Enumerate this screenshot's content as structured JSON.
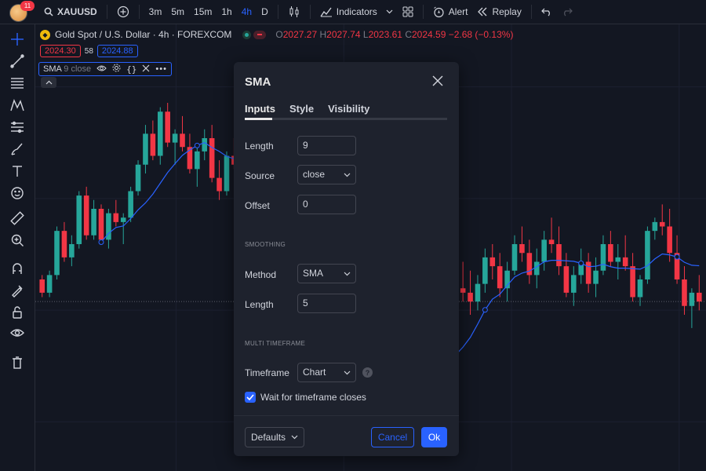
{
  "topbar": {
    "notification_count": "11",
    "symbol": "XAUUSD",
    "timeframes": [
      "3m",
      "5m",
      "15m",
      "1h",
      "4h",
      "D"
    ],
    "active_timeframe": "4h",
    "indicators_label": "Indicators",
    "alert_label": "Alert",
    "replay_label": "Replay"
  },
  "legend": {
    "title": "Gold Spot / U.S. Dollar · 4h · FOREXCOM",
    "open_key": "O",
    "open": "2027.27",
    "high_key": "H",
    "high": "2027.74",
    "low_key": "L",
    "low": "2023.61",
    "close_key": "C",
    "close": "2024.59",
    "change": "−2.68 (−0.13%)",
    "bid": "2024.30",
    "spread": "58",
    "ask": "2024.88",
    "indicator_name": "SMA",
    "indicator_params": "9 close"
  },
  "colors": {
    "up": "#26a69a",
    "down": "#f23645",
    "sma_line": "#2962ff",
    "accent": "#2962ff"
  },
  "left_tools": [
    "crosshair-icon",
    "trend-line-icon",
    "fib-icon",
    "pattern-icon",
    "prediction-icon",
    "brush-icon",
    "text-icon",
    "emoji-icon",
    "ruler-icon",
    "zoom-icon",
    "magnet-icon",
    "lock-drawing-icon",
    "lock-icon",
    "eye-icon",
    "trash-icon"
  ],
  "dialog": {
    "title": "SMA",
    "tabs": [
      "Inputs",
      "Style",
      "Visibility"
    ],
    "active_tab": "Inputs",
    "length_label": "Length",
    "length_value": "9",
    "source_label": "Source",
    "source_value": "close",
    "offset_label": "Offset",
    "offset_value": "0",
    "smoothing_section": "SMOOTHING",
    "method_label": "Method",
    "method_value": "SMA",
    "smoothing_length_label": "Length",
    "smoothing_length_value": "5",
    "mtf_section": "MULTI TIMEFRAME",
    "timeframe_label": "Timeframe",
    "timeframe_value": "Chart",
    "wait_label": "Wait for timeframe closes",
    "wait_checked": true,
    "defaults_label": "Defaults",
    "cancel_label": "Cancel",
    "ok_label": "Ok"
  },
  "chart_data": {
    "type": "candlestick",
    "symbol": "XAUUSD",
    "interval": "4h",
    "ohlc": [
      [
        100,
        101,
        96,
        97
      ],
      [
        97,
        102,
        96,
        101
      ],
      [
        101,
        112,
        100,
        111
      ],
      [
        111,
        113,
        104,
        105
      ],
      [
        105,
        110,
        103,
        108
      ],
      [
        108,
        120,
        107,
        119
      ],
      [
        119,
        121,
        109,
        110
      ],
      [
        110,
        118,
        109,
        116
      ],
      [
        116,
        117,
        108,
        109
      ],
      [
        109,
        116,
        107,
        115
      ],
      [
        115,
        118,
        112,
        113
      ],
      [
        113,
        115,
        108,
        114
      ],
      [
        114,
        121,
        113,
        120
      ],
      [
        120,
        127,
        119,
        126
      ],
      [
        126,
        135,
        124,
        133
      ],
      [
        133,
        136,
        127,
        128
      ],
      [
        128,
        139,
        126,
        138
      ],
      [
        138,
        140,
        130,
        131
      ],
      [
        131,
        134,
        126,
        133
      ],
      [
        133,
        137,
        129,
        130
      ],
      [
        130,
        133,
        124,
        125
      ],
      [
        125,
        130,
        121,
        129
      ],
      [
        129,
        134,
        127,
        132
      ],
      [
        132,
        135,
        122,
        123
      ],
      [
        123,
        127,
        118,
        120
      ],
      [
        120,
        129,
        119,
        128
      ],
      [
        128,
        132,
        125,
        126
      ],
      [
        126,
        128,
        116,
        118
      ],
      [
        118,
        124,
        114,
        122
      ],
      [
        122,
        128,
        120,
        127
      ],
      [
        127,
        131,
        123,
        124
      ],
      [
        124,
        126,
        115,
        117
      ],
      [
        117,
        121,
        113,
        119
      ],
      [
        119,
        124,
        114,
        115
      ],
      [
        115,
        120,
        108,
        110
      ],
      [
        110,
        118,
        109,
        116
      ],
      [
        116,
        121,
        113,
        115
      ],
      [
        115,
        119,
        107,
        108
      ],
      [
        108,
        112,
        100,
        101
      ],
      [
        101,
        105,
        95,
        96
      ],
      [
        96,
        100,
        90,
        92
      ],
      [
        92,
        98,
        88,
        97
      ],
      [
        97,
        101,
        93,
        94
      ],
      [
        94,
        98,
        86,
        87
      ],
      [
        87,
        92,
        80,
        82
      ],
      [
        82,
        88,
        78,
        86
      ],
      [
        86,
        94,
        84,
        92
      ],
      [
        92,
        95,
        85,
        88
      ],
      [
        88,
        93,
        79,
        81
      ],
      [
        81,
        84,
        73,
        75
      ],
      [
        75,
        80,
        70,
        72
      ],
      [
        72,
        78,
        68,
        76
      ],
      [
        76,
        83,
        74,
        81
      ],
      [
        81,
        89,
        79,
        88
      ],
      [
        88,
        90,
        82,
        84
      ],
      [
        84,
        92,
        82,
        91
      ],
      [
        91,
        99,
        89,
        98
      ],
      [
        98,
        104,
        95,
        97
      ],
      [
        97,
        102,
        92,
        95
      ],
      [
        95,
        101,
        93,
        99
      ],
      [
        99,
        107,
        97,
        105
      ],
      [
        105,
        108,
        100,
        103
      ],
      [
        103,
        106,
        96,
        98
      ],
      [
        98,
        104,
        95,
        102
      ],
      [
        102,
        110,
        101,
        108
      ],
      [
        108,
        112,
        104,
        106
      ],
      [
        106,
        109,
        99,
        101
      ],
      [
        101,
        107,
        98,
        104
      ],
      [
        104,
        111,
        102,
        109
      ],
      [
        109,
        114,
        106,
        108
      ],
      [
        108,
        112,
        101,
        103
      ],
      [
        103,
        106,
        96,
        97
      ],
      [
        97,
        103,
        94,
        101
      ],
      [
        101,
        107,
        99,
        104
      ],
      [
        104,
        106,
        97,
        99
      ],
      [
        99,
        105,
        96,
        102
      ],
      [
        102,
        110,
        101,
        108
      ],
      [
        108,
        111,
        103,
        104
      ],
      [
        104,
        108,
        100,
        105
      ],
      [
        105,
        110,
        102,
        103
      ],
      [
        103,
        106,
        95,
        96
      ],
      [
        96,
        101,
        94,
        100
      ],
      [
        100,
        112,
        99,
        111
      ],
      [
        111,
        114,
        109,
        113
      ],
      [
        113,
        117,
        110,
        112
      ],
      [
        112,
        116,
        104,
        106
      ],
      [
        106,
        110,
        99,
        100
      ],
      [
        100,
        103,
        92,
        94
      ],
      [
        94,
        98,
        89,
        97
      ],
      [
        97,
        101,
        93,
        95
      ]
    ],
    "sma_length": 9,
    "sma_source": "close",
    "grid": true
  }
}
